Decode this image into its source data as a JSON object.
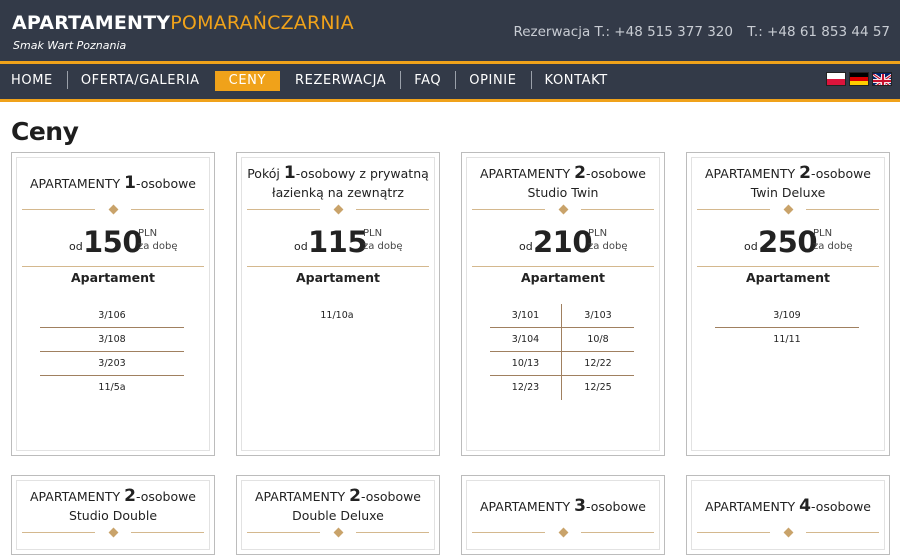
{
  "header": {
    "logo_part1": "APARTAMENTY",
    "logo_part2": "POMARAŃCZARNIA",
    "tagline": "Smak Wart Poznania",
    "phone1": "Rezerwacja T.: +48 515 377 320",
    "phone2": "T.: +48 61 853 44 57"
  },
  "nav": {
    "items": [
      "HOME",
      "OFERTA/GALERIA",
      "CENY",
      "REZERWACJA",
      "FAQ",
      "OPINIE",
      "KONTAKT"
    ],
    "active": "CENY"
  },
  "flags": [
    "flag-pl-icon",
    "flag-de-icon",
    "flag-en-icon"
  ],
  "page_title": "Ceny",
  "colors": {
    "header_bg": "#333a48",
    "accent": "#f0a21a",
    "ornament": "#c9a36a"
  },
  "common": {
    "od": "od",
    "pln": "PLN",
    "per_day": "za dobę",
    "apartment_label": "Apartament"
  },
  "cards": [
    {
      "title_pre": "APARTAMENTY ",
      "title_num": "1",
      "title_post": "-osobowe",
      "subtitle": "",
      "price": "150",
      "rooms": [
        "3/106",
        "3/108",
        "3/203",
        "11/5a"
      ]
    },
    {
      "title_pre": "Pokój ",
      "title_num": "1",
      "title_post": "-osobowy z prywatną",
      "subtitle": "łazienką na zewnątrz",
      "price": "115",
      "rooms": [
        "11/10a"
      ]
    },
    {
      "title_pre": "APARTAMENTY ",
      "title_num": "2",
      "title_post": "-osobowe",
      "subtitle": "Studio Twin",
      "price": "210",
      "rooms_grid": [
        [
          "3/101",
          "3/103"
        ],
        [
          "3/104",
          "10/8"
        ],
        [
          "10/13",
          "12/22"
        ],
        [
          "12/23",
          "12/25"
        ]
      ]
    },
    {
      "title_pre": "APARTAMENTY ",
      "title_num": "2",
      "title_post": "-osobowe",
      "subtitle": "Twin Deluxe",
      "price": "250",
      "rooms": [
        "3/109",
        "11/11"
      ]
    },
    {
      "title_pre": "APARTAMENTY ",
      "title_num": "2",
      "title_post": "-osobowe",
      "subtitle": "Studio Double"
    },
    {
      "title_pre": "APARTAMENTY ",
      "title_num": "2",
      "title_post": "-osobowe",
      "subtitle": "Double Deluxe"
    },
    {
      "title_pre": "APARTAMENTY ",
      "title_num": "3",
      "title_post": "-osobowe",
      "subtitle": ""
    },
    {
      "title_pre": "APARTAMENTY ",
      "title_num": "4",
      "title_post": "-osobowe",
      "subtitle": ""
    }
  ]
}
